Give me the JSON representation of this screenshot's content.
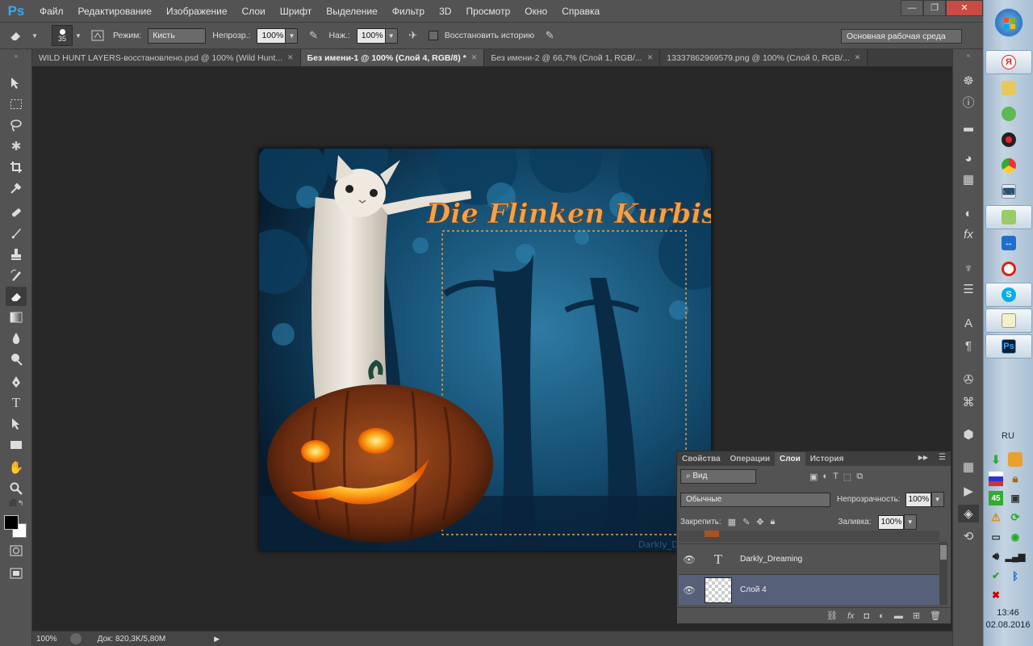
{
  "app": {
    "logo": "Ps"
  },
  "menu": [
    "Файл",
    "Редактирование",
    "Изображение",
    "Слои",
    "Шрифт",
    "Выделение",
    "Фильтр",
    "3D",
    "Просмотр",
    "Окно",
    "Справка"
  ],
  "window_controls": {
    "minimize": "—",
    "maximize": "❐",
    "close": "✕"
  },
  "options_bar": {
    "brush_size": "35",
    "mode_label": "Режим:",
    "mode_value": "Кисть",
    "opacity_label": "Непрозр.:",
    "opacity_value": "100%",
    "flow_label": "Наж.:",
    "flow_value": "100%",
    "restore_history_label": "Восстановить историю",
    "workspace": "Основная рабочая среда"
  },
  "tabs": [
    {
      "title": "WILD HUNT LAYERS-восстановлено.psd @ 100% (Wild Hunt...",
      "active": false
    },
    {
      "title": "Без имени-1 @ 100% (Слой 4, RGB/8) *",
      "active": true
    },
    {
      "title": "Без имени-2 @ 66,7% (Слой 1, RGB/...",
      "active": false
    },
    {
      "title": "13337862969579.png @ 100% (Слой 0, RGB/...",
      "active": false
    }
  ],
  "tab_close": "✕",
  "tools": [
    "move-tool",
    "marquee-tool",
    "lasso-tool",
    "magic-wand-tool",
    "crop-tool",
    "eyedropper-tool",
    "healing-brush-tool",
    "brush-tool",
    "clone-stamp-tool",
    "history-brush-tool",
    "eraser-tool",
    "gradient-tool",
    "blur-tool",
    "dodge-tool",
    "pen-tool",
    "type-tool",
    "path-selection-tool",
    "rectangle-tool",
    "hand-tool",
    "zoom-tool"
  ],
  "canvas": {
    "title_text": "Die Flinken Kurbisse",
    "watermark": "Darkly_D..."
  },
  "status_bar": {
    "zoom": "100%",
    "doc_info": "Док: 820,3K/5,80M"
  },
  "layers_panel": {
    "tabs": [
      "Свойства",
      "Операции",
      "Слои",
      "История"
    ],
    "active_tab": "Слои",
    "filter_label": "Вид",
    "blend_mode": "Обычные",
    "opacity_label": "Непрозрачность:",
    "opacity_value": "100%",
    "lock_label": "Закрепить:",
    "fill_label": "Заливка:",
    "fill_value": "100%",
    "layers": [
      {
        "name": "Darkly_Dreaming",
        "type": "text",
        "selected": false
      },
      {
        "name": "Слой 4",
        "type": "raster",
        "selected": true
      }
    ],
    "text_layer_glyph": "T"
  },
  "taskbar": {
    "language": "RU",
    "time": "13:46",
    "date": "02.08.2016",
    "tray_number": "45"
  },
  "colors": {
    "accent_title": "#f2a24a",
    "selection_border": "#e8a04a",
    "ps_blue": "#31a8ff"
  }
}
